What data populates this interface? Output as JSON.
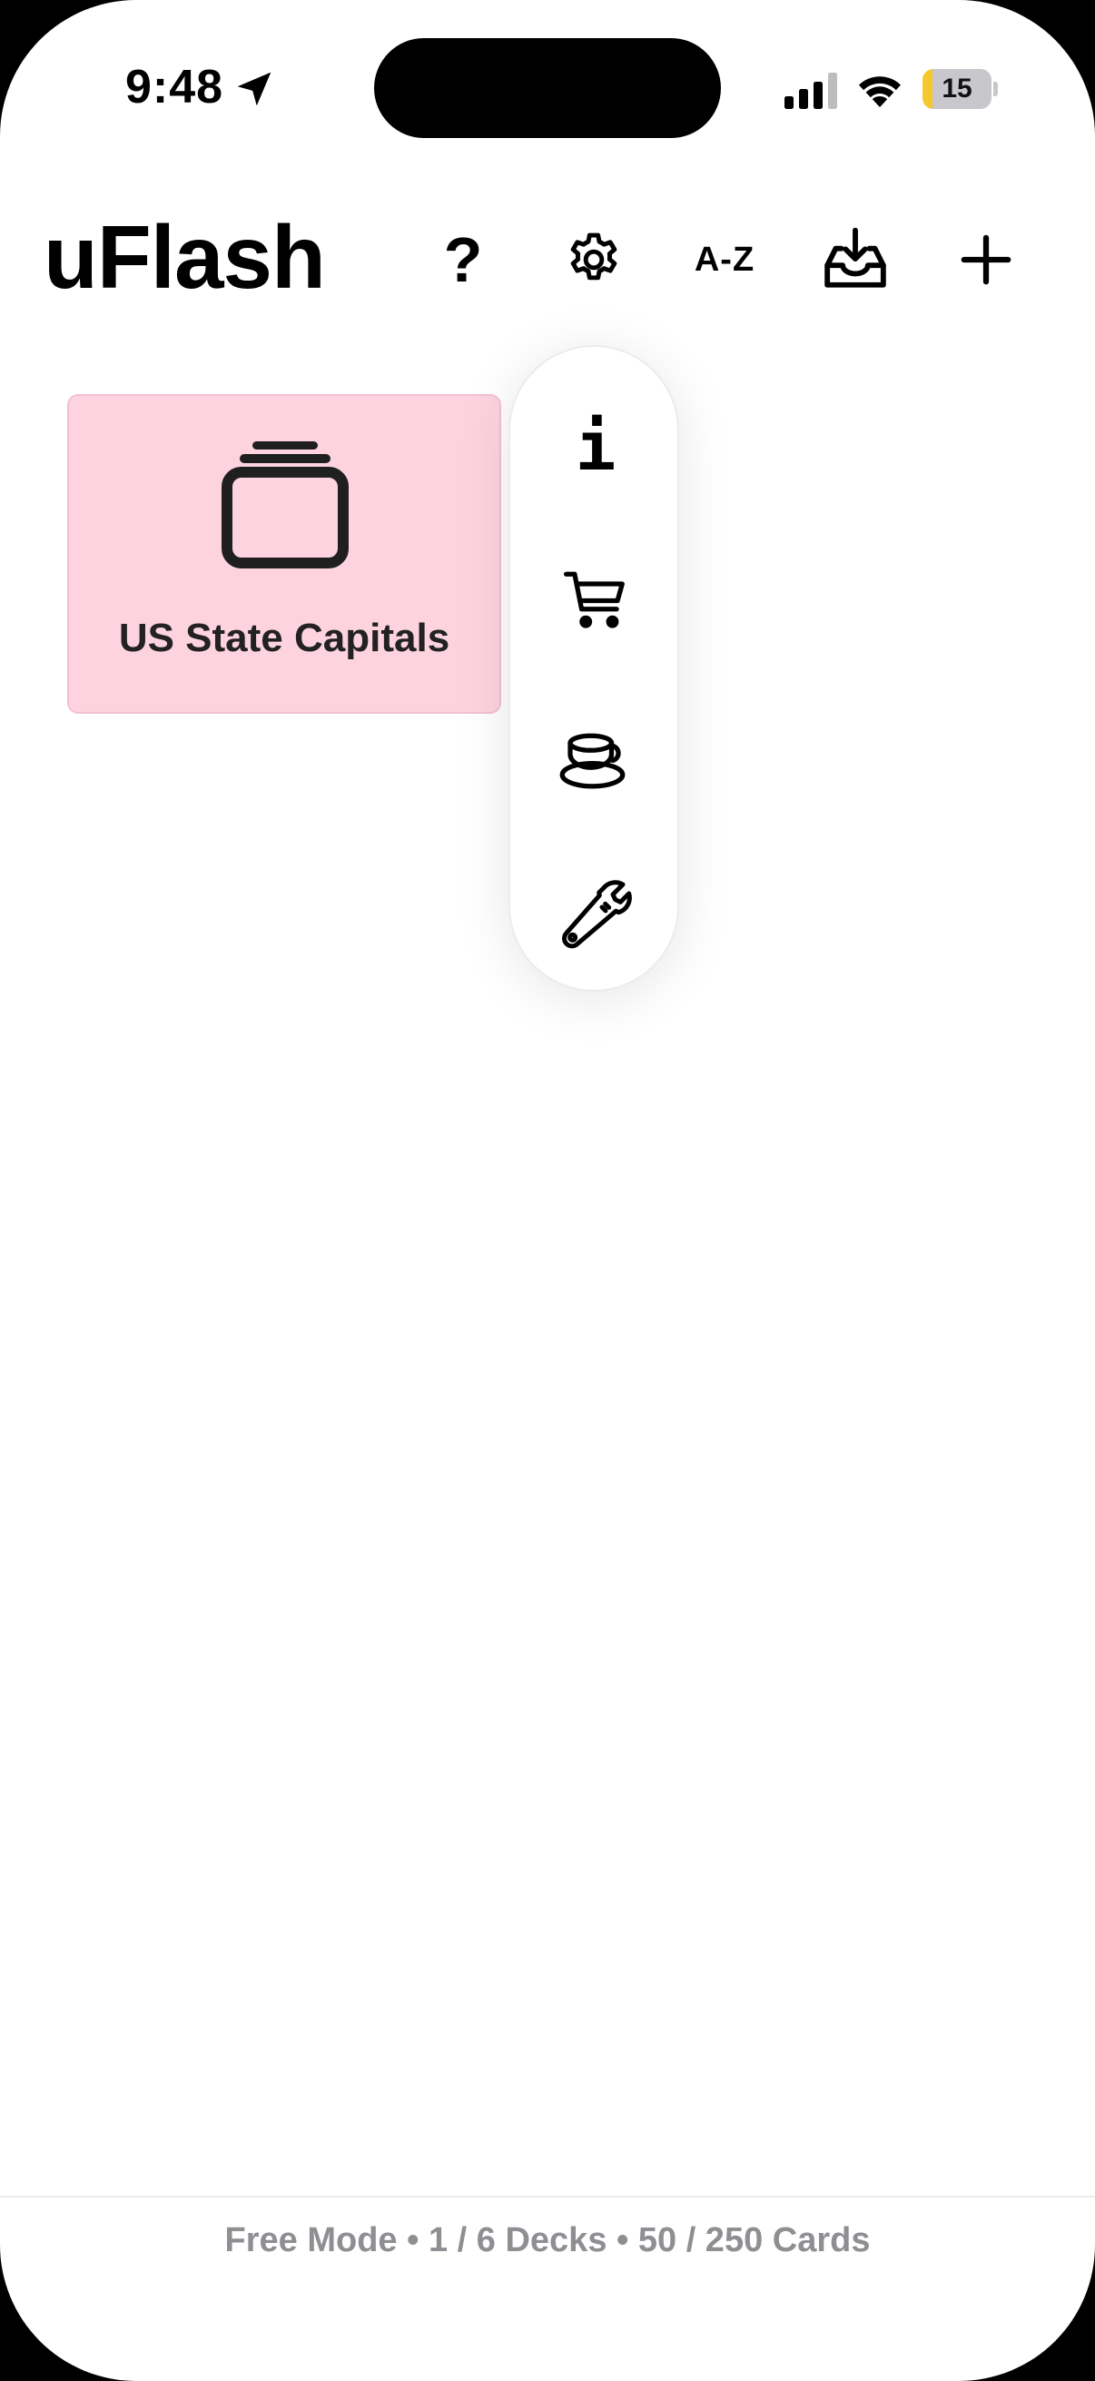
{
  "status_bar": {
    "time": "9:48",
    "battery_level": "15",
    "battery_fill_percent": 15,
    "icons": [
      "location-arrow-icon",
      "cellular-signal-icon",
      "wifi-icon",
      "battery-icon"
    ]
  },
  "header": {
    "title": "uFlash",
    "help_label": "?",
    "sort_label": "A-Z",
    "icons": [
      "help-icon",
      "gear-icon",
      "sort-az-icon",
      "import-tray-icon",
      "plus-icon"
    ]
  },
  "decks": [
    {
      "title": "US State Capitals",
      "icon": "card-stack-icon",
      "color": "#fdd3df"
    }
  ],
  "settings_menu": {
    "info_glyph": "i",
    "icons": [
      "info-icon",
      "shopping-cart-icon",
      "tea-cup-icon",
      "wrench-icon"
    ]
  },
  "footer": {
    "status": "Free Mode • 1 / 6 Decks • 50 / 250 Cards"
  },
  "colors": {
    "deck_pink": "#fdd3df",
    "footer_gray": "#8e8e93",
    "battery_yellow": "#f5c92e"
  }
}
